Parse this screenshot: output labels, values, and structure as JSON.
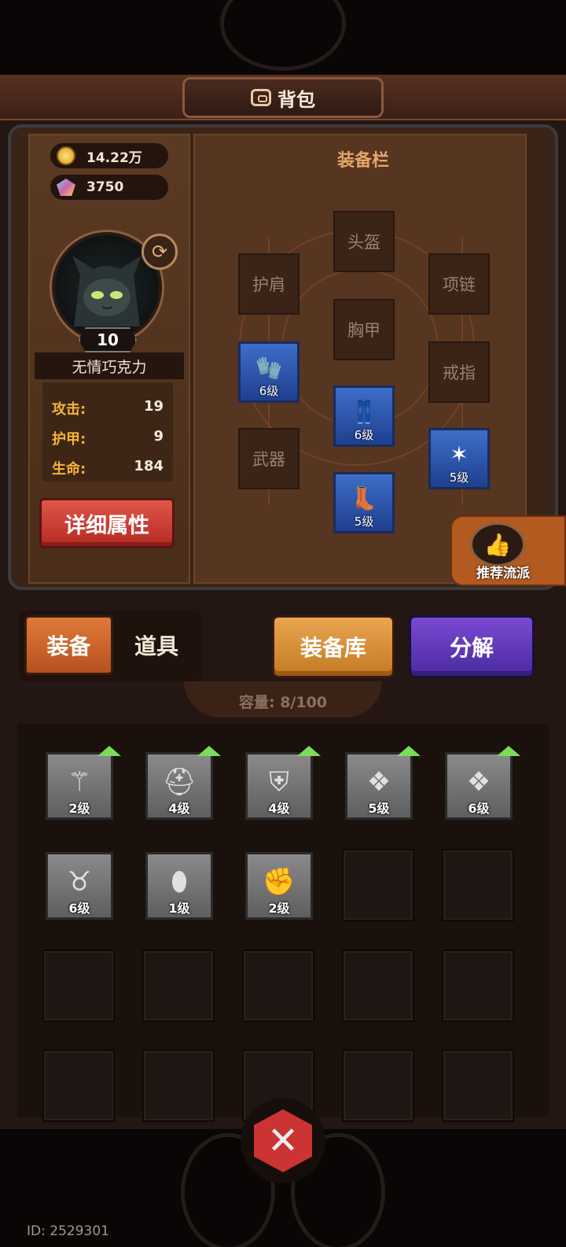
{
  "header": {
    "title": "背包"
  },
  "resources": {
    "gold": "14.22万",
    "gems": "3750"
  },
  "hero": {
    "level": "10",
    "name": "无情巧克力"
  },
  "stats": [
    {
      "label": "攻击:",
      "value": "19"
    },
    {
      "label": "护甲:",
      "value": "9"
    },
    {
      "label": "生命:",
      "value": "184"
    }
  ],
  "detail_button": "详细属性",
  "equipment": {
    "title": "装备栏",
    "slots": {
      "helmet": "头盔",
      "shoulder": "护肩",
      "necklace": "项链",
      "chest": "胸甲",
      "ring": "戒指",
      "weapon": "武器"
    },
    "equipped": {
      "gloves": "6级",
      "pants": "6级",
      "doll": "5级",
      "boots": "5级"
    }
  },
  "recommend": "推荐流派",
  "tabs": {
    "equipment": "装备",
    "items": "道具"
  },
  "buttons": {
    "library": "装备库",
    "decompose": "分解"
  },
  "capacity": {
    "label": "容量:",
    "value": "8/100"
  },
  "inventory": [
    {
      "icon": "staff-icon",
      "level": "2级",
      "upgrade": true
    },
    {
      "icon": "horned-helmet-icon",
      "level": "4级",
      "upgrade": true
    },
    {
      "icon": "knight-helmet-icon",
      "level": "4级",
      "upgrade": true
    },
    {
      "icon": "amulet-icon",
      "level": "5级",
      "upgrade": true
    },
    {
      "icon": "amulet-icon",
      "level": "6级",
      "upgrade": true
    },
    {
      "icon": "viking-helmet-icon",
      "level": "6级",
      "upgrade": false
    },
    {
      "icon": "egg-icon",
      "level": "1级",
      "upgrade": false
    },
    {
      "icon": "gauntlet-icon",
      "level": "2级",
      "upgrade": false
    }
  ],
  "footer": {
    "id": "ID: 2529301"
  }
}
